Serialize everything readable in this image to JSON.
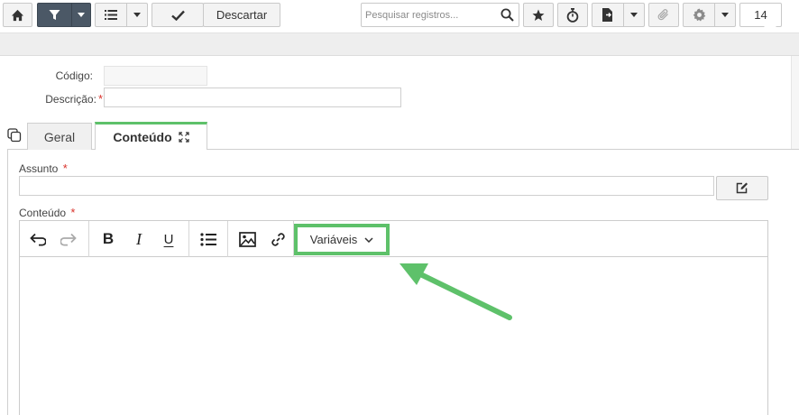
{
  "toolbar": {
    "descartar_label": "Descartar",
    "search_placeholder": "Pesquisar registros...",
    "record_count": "14",
    "icons": [
      "home-icon",
      "filter-icon",
      "caret-down-icon",
      "list-icon",
      "check-icon",
      "search-icon",
      "star-icon",
      "stopwatch-icon",
      "export-icon",
      "paperclip-icon",
      "gear-icon"
    ]
  },
  "form": {
    "codigo_label": "Código:",
    "codigo_value": "",
    "descricao_label": "Descrição:",
    "descricao_value": "",
    "required_mark": "*"
  },
  "tabs": [
    {
      "label": "Geral",
      "active": false
    },
    {
      "label": "Conteúdo",
      "active": true
    }
  ],
  "conteudo_tab": {
    "assunto_label": "Assunto",
    "assunto_value": "",
    "conteudo_label": "Conteúdo",
    "editor": {
      "variaveis_label": "Variáveis",
      "bold_glyph": "B",
      "italic_glyph": "I",
      "underline_glyph": "U",
      "body_text": ""
    }
  },
  "colors": {
    "accent_green": "#5ec16a",
    "required_red": "#d9322b",
    "filter_button": "#4b5866"
  }
}
